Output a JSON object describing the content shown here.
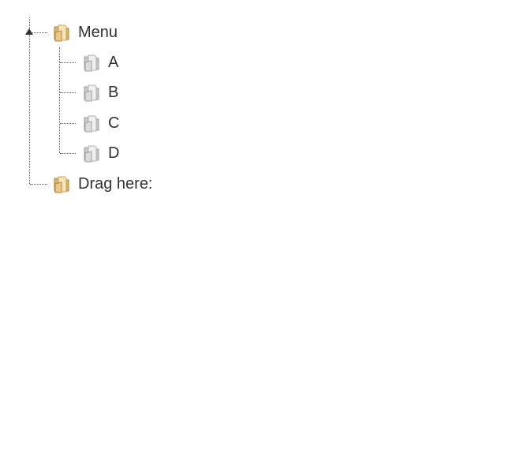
{
  "tree": {
    "root": {
      "label": "Menu",
      "icon": "folder-open-icon",
      "expanded": true,
      "children": [
        {
          "label": "A",
          "icon": "folder-gray-icon"
        },
        {
          "label": "B",
          "icon": "folder-gray-icon"
        },
        {
          "label": "C",
          "icon": "folder-gray-icon"
        },
        {
          "label": "D",
          "icon": "folder-gray-icon"
        }
      ]
    },
    "drop_target": {
      "label": "Drag here:",
      "icon": "folder-open-icon"
    }
  },
  "colors": {
    "text": "#333333",
    "connector": "#555555",
    "folder_tan": "#e8c98a",
    "folder_gray": "#d6d6d6"
  }
}
